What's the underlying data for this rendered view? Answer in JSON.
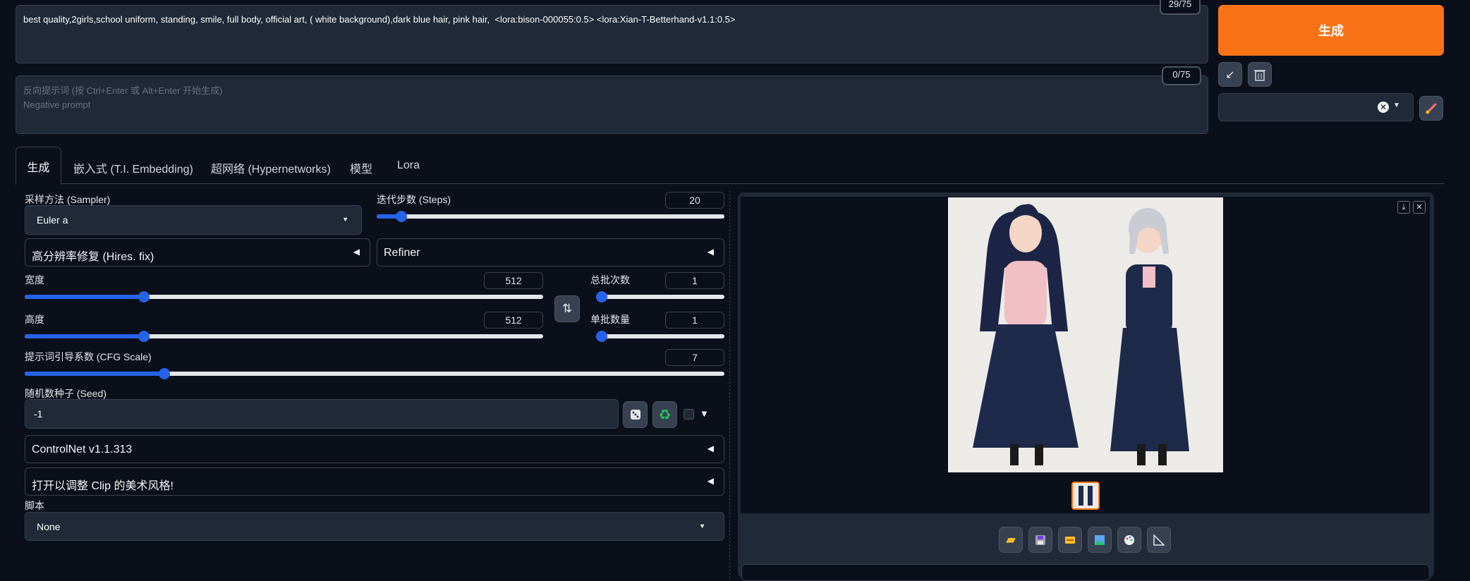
{
  "prompt": {
    "text": "best quality,2girls,school uniform, standing, smile, full body, official art, ( white background),dark blue hair, pink hair,  <lora:bison-000055:0.5> <lora:Xian-T-Betterhand-v1.1:0.5>",
    "counter": "29/75"
  },
  "negative_prompt": {
    "placeholder_line1": "反向提示词 (按 Ctrl+Enter 或 Alt+Enter 开始生成)",
    "placeholder_line2": "Negative prompt",
    "counter": "0/75"
  },
  "generate_button": "生成",
  "tabs": [
    "生成",
    "嵌入式 (T.I. Embedding)",
    "超网络 (Hypernetworks)",
    "模型",
    "Lora"
  ],
  "sampler": {
    "label": "采样方法 (Sampler)",
    "value": "Euler a"
  },
  "steps": {
    "label": "迭代步数 (Steps)",
    "value": "20",
    "fraction": 0.07
  },
  "hires_fix": "高分辨率修复 (Hires. fix)",
  "refiner": "Refiner",
  "width": {
    "label": "宽度",
    "value": "512",
    "fraction": 0.23
  },
  "height": {
    "label": "高度",
    "value": "512",
    "fraction": 0.23
  },
  "batch_count": {
    "label": "总批次数",
    "value": "1",
    "fraction": 0.0
  },
  "batch_size": {
    "label": "单批数量",
    "value": "1",
    "fraction": 0.0
  },
  "cfg_scale": {
    "label": "提示词引导系数 (CFG Scale)",
    "value": "7",
    "fraction": 0.2
  },
  "seed": {
    "label": "随机数种子 (Seed)",
    "value": "-1"
  },
  "controlnet": "ControlNet v1.1.313",
  "clip_style": "打开以调整 Clip 的美术风格!",
  "script": {
    "label": "脚本",
    "value": "None"
  },
  "colors": {
    "accent": "#f97316",
    "slider": "#2563eb",
    "background": "#0b0f19"
  },
  "icons": [
    "arrow-icon",
    "trash-icon",
    "clear-icon",
    "dropdown-icon",
    "brush-icon",
    "swap-icon",
    "dice-icon",
    "recycle-icon",
    "download-icon",
    "close-icon",
    "folder-icon",
    "save-icon",
    "zip-icon",
    "image-icon",
    "palette-icon",
    "ruler-icon"
  ]
}
